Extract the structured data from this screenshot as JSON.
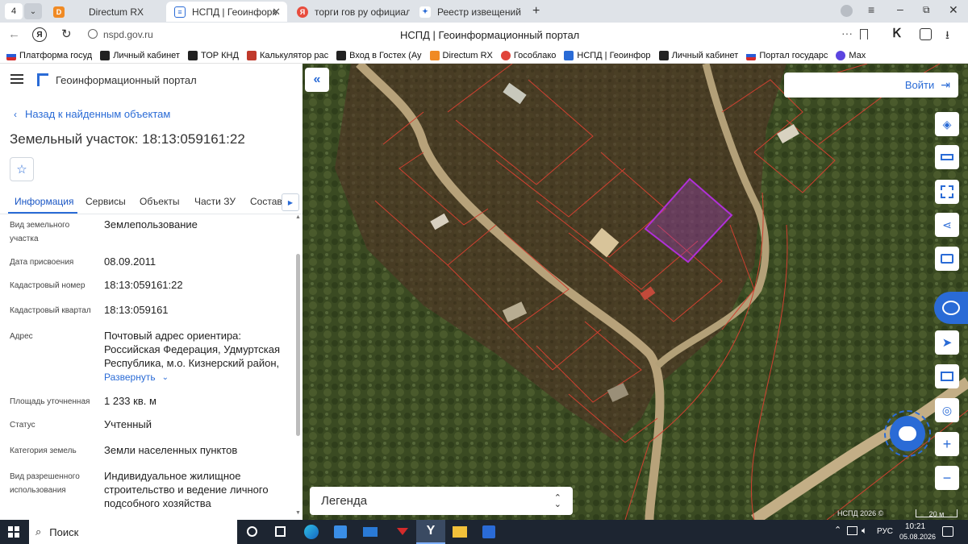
{
  "browser": {
    "tab_count": "4",
    "tabs": [
      {
        "label": "Directum RX"
      },
      {
        "label": "НСПД | Геоинформаци"
      },
      {
        "label": "торги гов ру официальн"
      },
      {
        "label": "Реестр извещений"
      }
    ],
    "url": "nspd.gov.ru",
    "page_title": "НСПД | Геоинформационный портал",
    "bookmarks": [
      {
        "label": "Платформа госуд"
      },
      {
        "label": "Личный кабинет"
      },
      {
        "label": "ТОР КНД"
      },
      {
        "label": "Калькулятор рас"
      },
      {
        "label": "Вход в Гостех (Ау"
      },
      {
        "label": "Directum RX"
      },
      {
        "label": "Гособлако"
      },
      {
        "label": "НСПД | Геоинфор"
      },
      {
        "label": "Личный кабинет"
      },
      {
        "label": "Портал государс"
      },
      {
        "label": "Max"
      }
    ]
  },
  "portal": {
    "title": "Геоинформационный портал",
    "back_link": "Назад к найденным объектам",
    "object_title": "Земельный участок: 18:13:059161:22",
    "tabs": [
      "Информация",
      "Сервисы",
      "Объекты",
      "Части ЗУ",
      "Состав"
    ],
    "fields": [
      {
        "label": "Вид земельного участка",
        "value": "Землепользование"
      },
      {
        "label": "Дата присвоения",
        "value": "08.09.2011"
      },
      {
        "label": "Кадастровый номер",
        "value": "18:13:059161:22"
      },
      {
        "label": "Кадастровый квартал",
        "value": "18:13:059161"
      },
      {
        "label": "Адрес",
        "value": "Почтовый адрес ориентира: Российская Федерация, Удмуртская Республика, м.о. Кизнерский район,"
      },
      {
        "label": "Площадь уточненная",
        "value": "1 233 кв. м"
      },
      {
        "label": "Статус",
        "value": "Учтенный"
      },
      {
        "label": "Категория земель",
        "value": "Земли населенных пунктов"
      },
      {
        "label": "Вид разрешенного использования",
        "value": "Индивидуальное жилищное строительство и ведение личного подсобного хозяйства"
      }
    ],
    "expand_link": "Развернуть"
  },
  "map": {
    "login_label": "Войти",
    "legend_label": "Легенда",
    "attribution": "НСПД 2026 ©",
    "scale_label": "20 м",
    "highlight_color": "#a040c0",
    "boundary_color": "#d04030"
  },
  "taskbar": {
    "search_label": "Поиск",
    "lang": "РУС",
    "time": "10:21",
    "date": "05.08.2026"
  }
}
